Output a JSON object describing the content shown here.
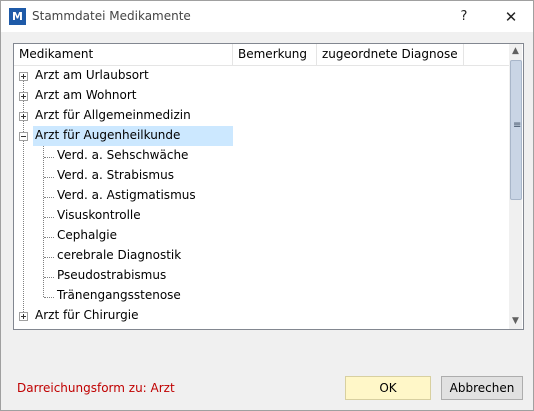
{
  "window": {
    "title": "Stammdatei Medikamente",
    "icon_text": "M",
    "help_label": "?",
    "close_label": "✕"
  },
  "tree": {
    "columns": [
      "Medikament",
      "Bemerkung",
      "zugeordnete Diagnose"
    ],
    "nodes": [
      {
        "label": "Arzt am Urlaubsort",
        "level": 0,
        "expander": "plus"
      },
      {
        "label": "Arzt am Wohnort",
        "level": 0,
        "expander": "plus"
      },
      {
        "label": "Arzt für Allgemeinmedizin",
        "level": 0,
        "expander": "plus"
      },
      {
        "label": "Arzt für Augenheilkunde",
        "level": 0,
        "expander": "minus",
        "selected": true
      },
      {
        "label": "Verd. a. Sehschwäche",
        "level": 1
      },
      {
        "label": "Verd. a. Strabismus",
        "level": 1
      },
      {
        "label": "Verd. a. Astigmatismus",
        "level": 1
      },
      {
        "label": "Visuskontrolle",
        "level": 1
      },
      {
        "label": "Cephalgie",
        "level": 1
      },
      {
        "label": "cerebrale Diagnostik",
        "level": 1
      },
      {
        "label": "Pseudostrabismus",
        "level": 1
      },
      {
        "label": "Tränengangsstenose",
        "level": 1
      },
      {
        "label": "Arzt für Chirurgie",
        "level": 0,
        "expander": "plus"
      }
    ],
    "scroll_up": "▲",
    "scroll_down": "▼",
    "scroll_grip": "≡"
  },
  "footer": {
    "message": "Darreichungsform zu: Arzt",
    "ok_label": "OK",
    "cancel_label": "Abbrechen"
  }
}
